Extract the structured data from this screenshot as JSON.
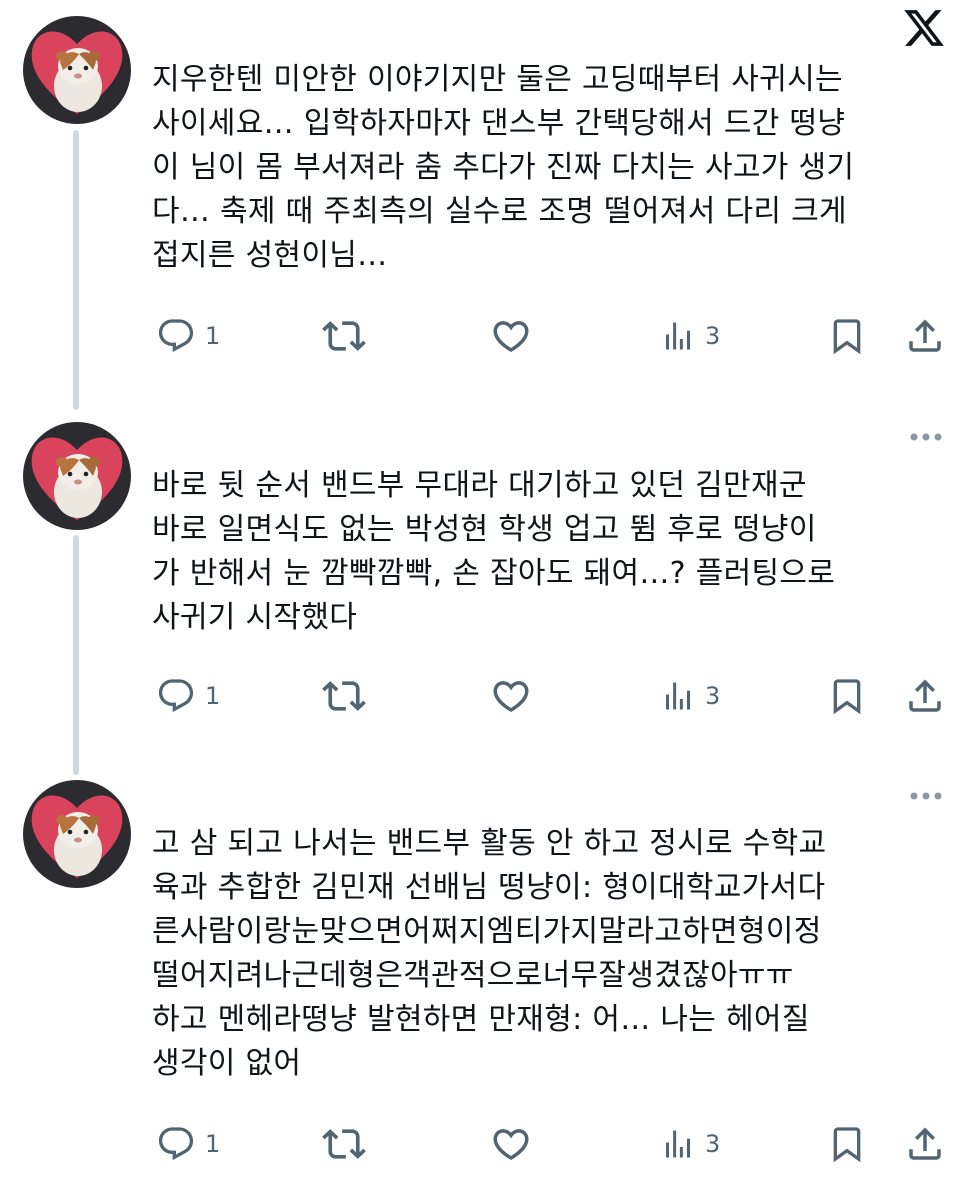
{
  "header": {
    "logo_icon": "x-logo-icon"
  },
  "colors": {
    "text": "#0f1419",
    "icon": "#536471",
    "thread_line": "#cfd9de",
    "avatar_bg": "#d9435b"
  },
  "tweets": [
    {
      "lines": [
        "지우한텐 미안한 이야기지만 둘은 고딩때부터 사귀시는",
        "사이세요… 입학하자마자 댄스부 간택당해서 드간 떵냥",
        "이 님이 몸 부서져라 춤 추다가 진짜 다치는 사고가 생기",
        "다… 축제 때 주최측의 실수로 조명 떨어져서 다리 크게",
        "접지른 성현이님…"
      ],
      "replies": "1",
      "retweets": "",
      "likes": "",
      "views": "3"
    },
    {
      "lines": [
        "바로 뒷 순서 밴드부 무대라 대기하고 있던 김만재군",
        "바로 일면식도 없는 박성현 학생 업고 뜀 후로 떵냥이",
        "가 반해서 눈 깜빡깜빡, 손 잡아도 돼여…? 플러팅으로",
        "사귀기 시작했다"
      ],
      "replies": "1",
      "retweets": "",
      "likes": "",
      "views": "3"
    },
    {
      "lines": [
        "고 삼 되고 나서는 밴드부 활동 안 하고 정시로 수학교",
        "육과 추합한 김민재 선배님 떵냥이: 형이대학교가서다",
        "른사람이랑눈맞으면어쩌지엠티가지말라고하면형이정",
        "떨어지려나근데형은객관적으로너무잘생겼잖아ㅠㅠ",
        "하고 멘헤라떵냥 발현하면 만재형: 어… 나는 헤어질",
        "생각이 없어"
      ],
      "replies": "1",
      "retweets": "",
      "likes": "",
      "views": "3"
    }
  ]
}
